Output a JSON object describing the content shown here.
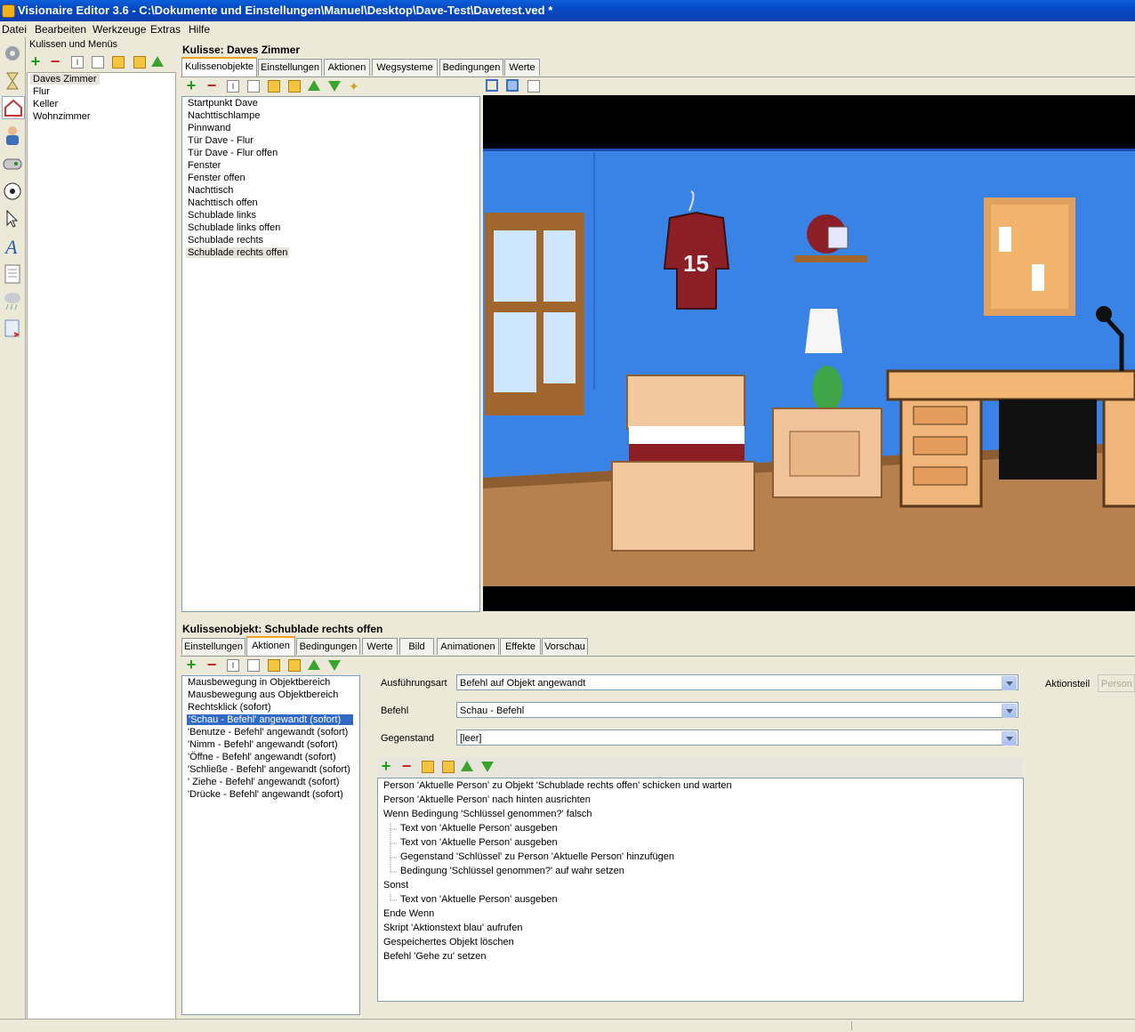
{
  "window": {
    "title": "Visionaire Editor 3.6 - C:\\Dokumente und Einstellungen\\Manuel\\Desktop\\Dave-Test\\Davetest.ved *"
  },
  "menu": [
    "Datei",
    "Bearbeiten",
    "Werkzeuge",
    "Extras",
    "Hilfe"
  ],
  "scenes_panel": {
    "title": "Kulissen und Menüs",
    "items": [
      "Daves Zimmer",
      "Flur",
      "Keller",
      "Wohnzimmer"
    ]
  },
  "scene": {
    "title": "Kulisse: Daves Zimmer",
    "tabs": [
      "Kulissenobjekte",
      "Einstellungen",
      "Aktionen",
      "Wegsysteme",
      "Bedingungen",
      "Werte"
    ],
    "objects": [
      "Startpunkt Dave",
      "Nachttischlampe",
      "Pinnwand",
      "Tür Dave - Flur",
      "Tür Dave - Flur offen",
      "Fenster",
      "Fenster offen",
      "Nachttisch",
      "Nachttisch offen",
      "Schublade links",
      "Schublade links offen",
      "Schublade rechts",
      "Schublade rechts offen"
    ],
    "preview_jersey_number": "15"
  },
  "object": {
    "title": "Kulissenobjekt: Schublade rechts offen",
    "tabs": [
      "Einstellungen",
      "Aktionen",
      "Bedingungen",
      "Werte",
      "Bild",
      "Animationen",
      "Effekte",
      "Vorschau"
    ],
    "actions": [
      "Mausbewegung in Objektbereich",
      "Mausbewegung aus Objektbereich",
      "Rechtsklick (sofort)",
      "'Schau - Befehl' angewandt (sofort)",
      "'Benutze - Befehl' angewandt (sofort)",
      "'Nimm - Befehl' angewandt (sofort)",
      "'Öffne - Befehl' angewandt (sofort)",
      "'Schließe - Befehl' angewandt (sofort)",
      "' Ziehe - Befehl' angewandt (sofort)",
      "'Drücke - Befehl' angewandt (sofort)"
    ]
  },
  "form": {
    "execution_label": "Ausführungsart",
    "execution_value": "Befehl auf Objekt angewandt",
    "command_label": "Befehl",
    "command_value": "Schau - Befehl",
    "item_label": "Gegenstand",
    "item_value": "[leer]",
    "actionpart_label": "Aktionsteil",
    "actionpart_value": "Person a"
  },
  "script_lines": [
    "Person 'Aktuelle Person' zu Objekt 'Schublade rechts offen' schicken und warten",
    "Person 'Aktuelle Person' nach hinten ausrichten",
    "Wenn Bedingung 'Schlüssel genommen?' falsch",
    "Text von 'Aktuelle Person' ausgeben",
    "Text von 'Aktuelle Person' ausgeben",
    "Gegenstand 'Schlüssel' zu Person 'Aktuelle Person' hinzufügen",
    "Bedingung 'Schlüssel genommen?' auf wahr setzen",
    "Sonst",
    "Text von 'Aktuelle Person' ausgeben",
    "Ende Wenn",
    "Skript 'Aktionstext blau' aufrufen",
    "Gespeichertes Objekt löschen",
    "Befehl 'Gehe zu' setzen"
  ]
}
